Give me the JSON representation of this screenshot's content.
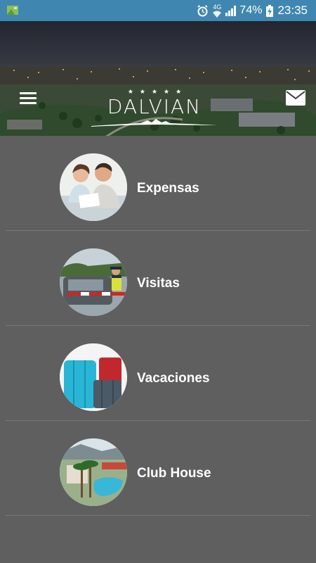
{
  "status_bar": {
    "network": "4G",
    "battery_percent": "74%",
    "time": "23:35",
    "icons": [
      "notification-image-icon",
      "alarm-icon",
      "wifi-icon",
      "signal-icon",
      "battery-charging-icon"
    ]
  },
  "header": {
    "brand": "DALVIAN",
    "stars": "★★★★★",
    "icons": [
      "hamburger-menu-icon",
      "mail-icon"
    ]
  },
  "menu": {
    "items": [
      {
        "label": "Expensas",
        "image": "couple-reviewing-bills"
      },
      {
        "label": "Visitas",
        "image": "security-guard-at-gate"
      },
      {
        "label": "Vacaciones",
        "image": "suitcases"
      },
      {
        "label": "Club House",
        "image": "pool-with-palm-trees"
      }
    ]
  },
  "colors": {
    "status_bar": "#3f87b0",
    "background": "#5f5f5f",
    "divider": "#777777",
    "text": "#ffffff"
  }
}
